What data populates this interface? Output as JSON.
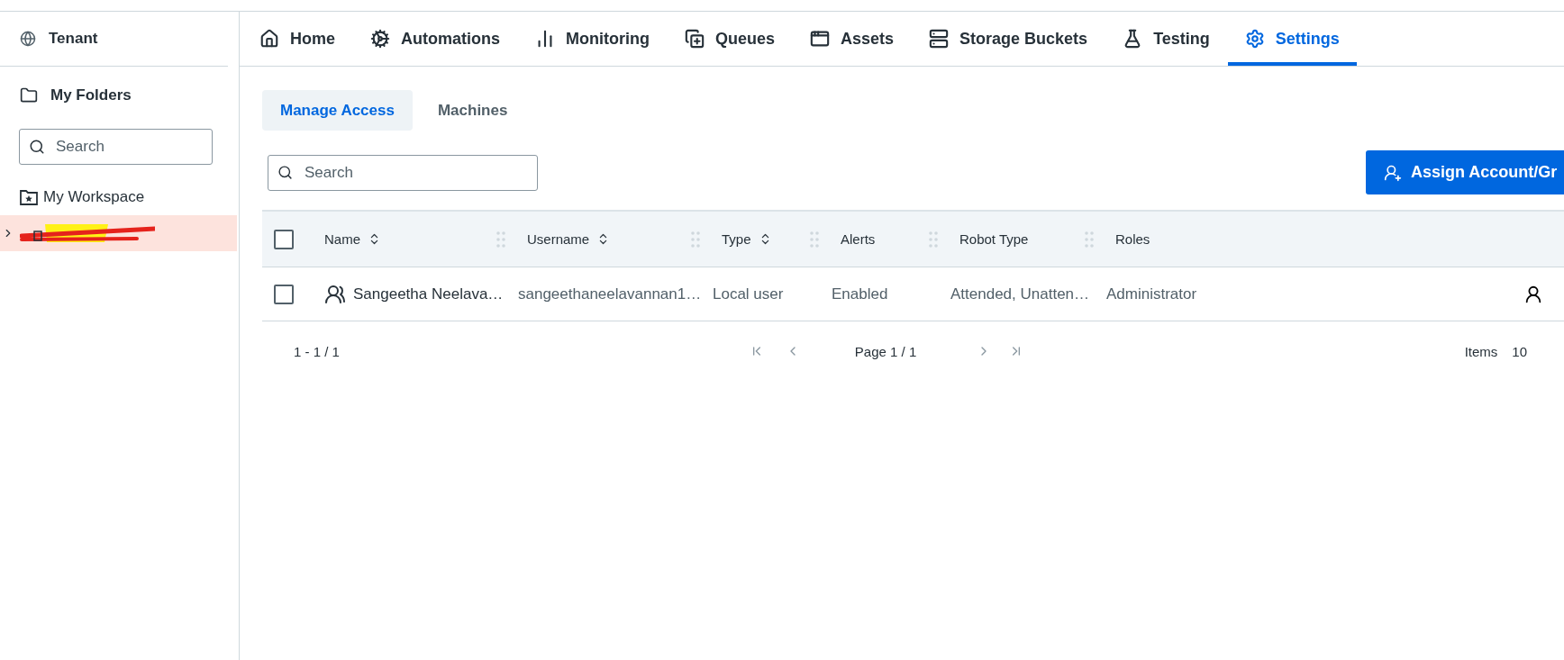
{
  "sidebar": {
    "tenant": "Tenant",
    "section": "My Folders",
    "search": {
      "placeholder": "Search"
    },
    "folders": [
      {
        "kind": "workspace",
        "label": "My Workspace",
        "selected": false,
        "expandable": false
      },
      {
        "kind": "redacted",
        "selected": true,
        "expandable": true
      }
    ]
  },
  "nav_tabs": [
    {
      "label": "Home",
      "selected": false
    },
    {
      "label": "Automations",
      "selected": false
    },
    {
      "label": "Monitoring",
      "selected": false
    },
    {
      "label": "Queues",
      "selected": false
    },
    {
      "label": "Assets",
      "selected": false
    },
    {
      "label": "Storage Buckets",
      "selected": false
    },
    {
      "label": "Testing",
      "selected": false
    },
    {
      "label": "Settings",
      "selected": true
    }
  ],
  "sub_tabs": [
    {
      "label": "Manage Access",
      "selected": true
    },
    {
      "label": "Machines",
      "selected": false
    }
  ],
  "search": {
    "placeholder": "Search"
  },
  "assign_button": "Assign Account/Gr",
  "table": {
    "select_all_checked": false,
    "columns": [
      {
        "label": "Name",
        "sortable": true
      },
      {
        "label": "Username",
        "sortable": true
      },
      {
        "label": "Type",
        "sortable": true
      },
      {
        "label": "Alerts",
        "sortable": false
      },
      {
        "label": "Robot Type",
        "sortable": false
      },
      {
        "label": "Roles",
        "sortable": false
      }
    ],
    "rows": [
      {
        "checked": false,
        "cells": [
          "Sangeetha Neelava…",
          "sangeethaneelavannan1…",
          "Local user",
          "Enabled",
          "Attended, Unatten…",
          "Administrator"
        ]
      }
    ]
  },
  "pagination": {
    "range": "1 - 1 / 1",
    "page": "Page 1 / 1",
    "items_label": "Items",
    "items_value": "10"
  }
}
